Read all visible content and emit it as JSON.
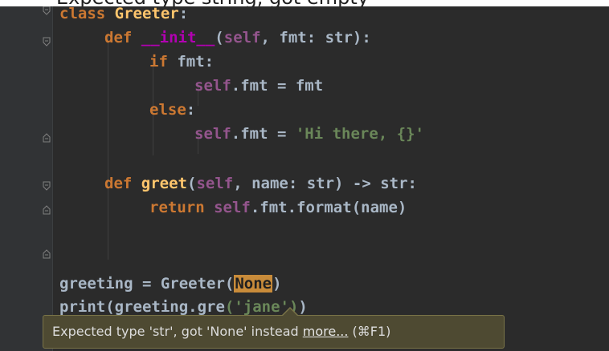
{
  "header": {
    "text": "Expected type string, got empty"
  },
  "code": {
    "line1": {
      "kw": "class",
      "name": "Greeter",
      "colon": ":"
    },
    "line2": {
      "kw": "def",
      "name": "__init__",
      "open": "(",
      "self": "self",
      "rest": ", fmt: str):"
    },
    "line3": {
      "kw": "if",
      "rest": " fmt:"
    },
    "line4": {
      "self": "self",
      "rest": ".fmt = fmt"
    },
    "line5": {
      "kw": "else",
      "colon": ":"
    },
    "line6": {
      "self": "self",
      "rest": ".fmt = ",
      "str": "'Hi there, {}'"
    },
    "line8": {
      "kw": "def",
      "name": "greet",
      "open": "(",
      "self": "self",
      "rest": ", name: str) -> str:"
    },
    "line9": {
      "kw": "return",
      "self": "self",
      "rest": ".fmt.format(name)"
    },
    "line12": {
      "pre": "greeting = Greeter(",
      "hl": "None",
      "post": ")"
    },
    "line13": {
      "pre": "print(greeting.gre",
      "str": "('jane')",
      "post": ")"
    }
  },
  "tooltip": {
    "message": "Expected type 'str', got 'None' instead",
    "link": "more...",
    "shortcut": "(⌘F1)"
  },
  "colors": {
    "background": "#2b2b2b",
    "gutter": "#313335",
    "keyword": "#cc7832",
    "function": "#ffc66d",
    "dunder": "#b200b2",
    "self": "#94558d",
    "string": "#6a8759",
    "text": "#a9b7c6",
    "highlight": "#c88b3a",
    "tooltip_bg": "#4e4a32"
  }
}
